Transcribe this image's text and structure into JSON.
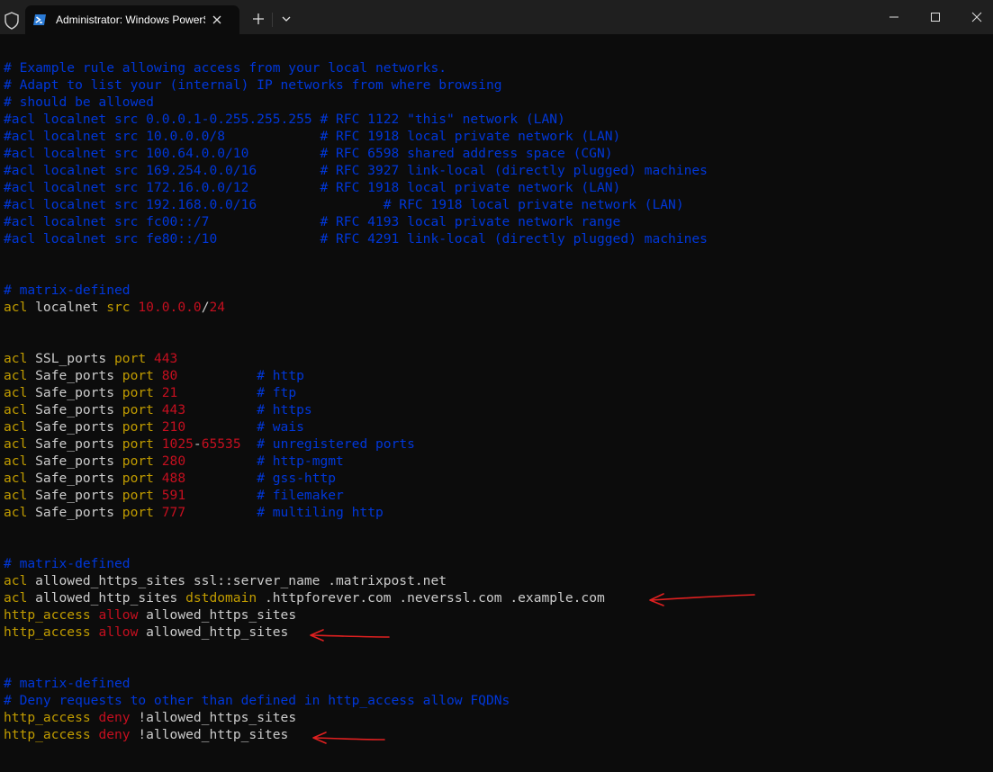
{
  "window": {
    "tab_title": "Administrator: Windows PowerShell",
    "colors": {
      "comment": "#0037da",
      "keyword": "#c19c00",
      "number": "#c50f1f",
      "text": "#cccccc",
      "background": "#0c0c0c",
      "titlebar": "#1f1f1f",
      "annotation_arrow": "#e02020"
    },
    "icons": [
      "shield-icon",
      "powershell-icon",
      "close-icon",
      "plus-icon",
      "chevron-down-icon",
      "minimize-icon",
      "maximize-icon",
      "close-window-icon"
    ]
  },
  "terminal": {
    "lines": [
      [
        [
          "c",
          "# Example rule allowing access from your local networks."
        ]
      ],
      [
        [
          "c",
          "# Adapt to list your (internal) IP networks from where browsing"
        ]
      ],
      [
        [
          "c",
          "# should be allowed"
        ]
      ],
      [
        [
          "c",
          "#acl localnet src 0.0.0.1-0.255.255.255 # RFC 1122 \"this\" network (LAN)"
        ]
      ],
      [
        [
          "c",
          "#acl localnet src 10.0.0.0/8            # RFC 1918 local private network (LAN)"
        ]
      ],
      [
        [
          "c",
          "#acl localnet src 100.64.0.0/10         # RFC 6598 shared address space (CGN)"
        ]
      ],
      [
        [
          "c",
          "#acl localnet src 169.254.0.0/16        # RFC 3927 link-local (directly plugged) machines"
        ]
      ],
      [
        [
          "c",
          "#acl localnet src 172.16.0.0/12         # RFC 1918 local private network (LAN)"
        ]
      ],
      [
        [
          "c",
          "#acl localnet src 192.168.0.0/16                # RFC 1918 local private network (LAN)"
        ]
      ],
      [
        [
          "c",
          "#acl localnet src fc00::/7              # RFC 4193 local private network range"
        ]
      ],
      [
        [
          "c",
          "#acl localnet src fe80::/10             # RFC 4291 link-local (directly plugged) machines"
        ]
      ],
      [],
      [],
      [
        [
          "c",
          "# matrix-defined"
        ]
      ],
      [
        [
          "k",
          "acl"
        ],
        [
          "w",
          " localnet "
        ],
        [
          "k",
          "src"
        ],
        [
          "w",
          " "
        ],
        [
          "n",
          "10.0.0.0"
        ],
        [
          "w",
          "/"
        ],
        [
          "n",
          "24"
        ]
      ],
      [],
      [],
      [
        [
          "k",
          "acl"
        ],
        [
          "w",
          " SSL_ports "
        ],
        [
          "k",
          "port"
        ],
        [
          "w",
          " "
        ],
        [
          "n",
          "443"
        ]
      ],
      [
        [
          "k",
          "acl"
        ],
        [
          "w",
          " Safe_ports "
        ],
        [
          "k",
          "port"
        ],
        [
          "w",
          " "
        ],
        [
          "n",
          "80"
        ],
        [
          "w",
          "          "
        ],
        [
          "c",
          "# http"
        ]
      ],
      [
        [
          "k",
          "acl"
        ],
        [
          "w",
          " Safe_ports "
        ],
        [
          "k",
          "port"
        ],
        [
          "w",
          " "
        ],
        [
          "n",
          "21"
        ],
        [
          "w",
          "          "
        ],
        [
          "c",
          "# ftp"
        ]
      ],
      [
        [
          "k",
          "acl"
        ],
        [
          "w",
          " Safe_ports "
        ],
        [
          "k",
          "port"
        ],
        [
          "w",
          " "
        ],
        [
          "n",
          "443"
        ],
        [
          "w",
          "         "
        ],
        [
          "c",
          "# https"
        ]
      ],
      [
        [
          "k",
          "acl"
        ],
        [
          "w",
          " Safe_ports "
        ],
        [
          "k",
          "port"
        ],
        [
          "w",
          " "
        ],
        [
          "n",
          "210"
        ],
        [
          "w",
          "         "
        ],
        [
          "c",
          "# wais"
        ]
      ],
      [
        [
          "k",
          "acl"
        ],
        [
          "w",
          " Safe_ports "
        ],
        [
          "k",
          "port"
        ],
        [
          "w",
          " "
        ],
        [
          "n",
          "1025"
        ],
        [
          "w",
          "-"
        ],
        [
          "n",
          "65535"
        ],
        [
          "w",
          "  "
        ],
        [
          "c",
          "# unregistered ports"
        ]
      ],
      [
        [
          "k",
          "acl"
        ],
        [
          "w",
          " Safe_ports "
        ],
        [
          "k",
          "port"
        ],
        [
          "w",
          " "
        ],
        [
          "n",
          "280"
        ],
        [
          "w",
          "         "
        ],
        [
          "c",
          "# http-mgmt"
        ]
      ],
      [
        [
          "k",
          "acl"
        ],
        [
          "w",
          " Safe_ports "
        ],
        [
          "k",
          "port"
        ],
        [
          "w",
          " "
        ],
        [
          "n",
          "488"
        ],
        [
          "w",
          "         "
        ],
        [
          "c",
          "# gss-http"
        ]
      ],
      [
        [
          "k",
          "acl"
        ],
        [
          "w",
          " Safe_ports "
        ],
        [
          "k",
          "port"
        ],
        [
          "w",
          " "
        ],
        [
          "n",
          "591"
        ],
        [
          "w",
          "         "
        ],
        [
          "c",
          "# filemaker"
        ]
      ],
      [
        [
          "k",
          "acl"
        ],
        [
          "w",
          " Safe_ports "
        ],
        [
          "k",
          "port"
        ],
        [
          "w",
          " "
        ],
        [
          "n",
          "777"
        ],
        [
          "w",
          "         "
        ],
        [
          "c",
          "# multiling http"
        ]
      ],
      [],
      [],
      [
        [
          "c",
          "# matrix-defined"
        ]
      ],
      [
        [
          "k",
          "acl"
        ],
        [
          "w",
          " allowed_https_sites ssl::server_name .matrixpost.net"
        ]
      ],
      [
        [
          "k",
          "acl"
        ],
        [
          "w",
          " allowed_http_sites "
        ],
        [
          "k",
          "dstdomain"
        ],
        [
          "w",
          " .httpforever.com .neverssl.com .example.com"
        ]
      ],
      [
        [
          "k",
          "http_access"
        ],
        [
          "w",
          " "
        ],
        [
          "n",
          "allow"
        ],
        [
          "w",
          " allowed_https_sites"
        ]
      ],
      [
        [
          "k",
          "http_access"
        ],
        [
          "w",
          " "
        ],
        [
          "n",
          "allow"
        ],
        [
          "w",
          " allowed_http_sites"
        ]
      ],
      [],
      [],
      [
        [
          "c",
          "# matrix-defined"
        ]
      ],
      [
        [
          "c",
          "# Deny requests to other than defined in http_access allow FQDNs"
        ]
      ],
      [
        [
          "k",
          "http_access"
        ],
        [
          "w",
          " "
        ],
        [
          "n",
          "deny"
        ],
        [
          "w",
          " !allowed_https_sites"
        ]
      ],
      [
        [
          "k",
          "http_access"
        ],
        [
          "w",
          " "
        ],
        [
          "n",
          "deny"
        ],
        [
          "w",
          " !allowed_http_sites"
        ]
      ]
    ]
  }
}
